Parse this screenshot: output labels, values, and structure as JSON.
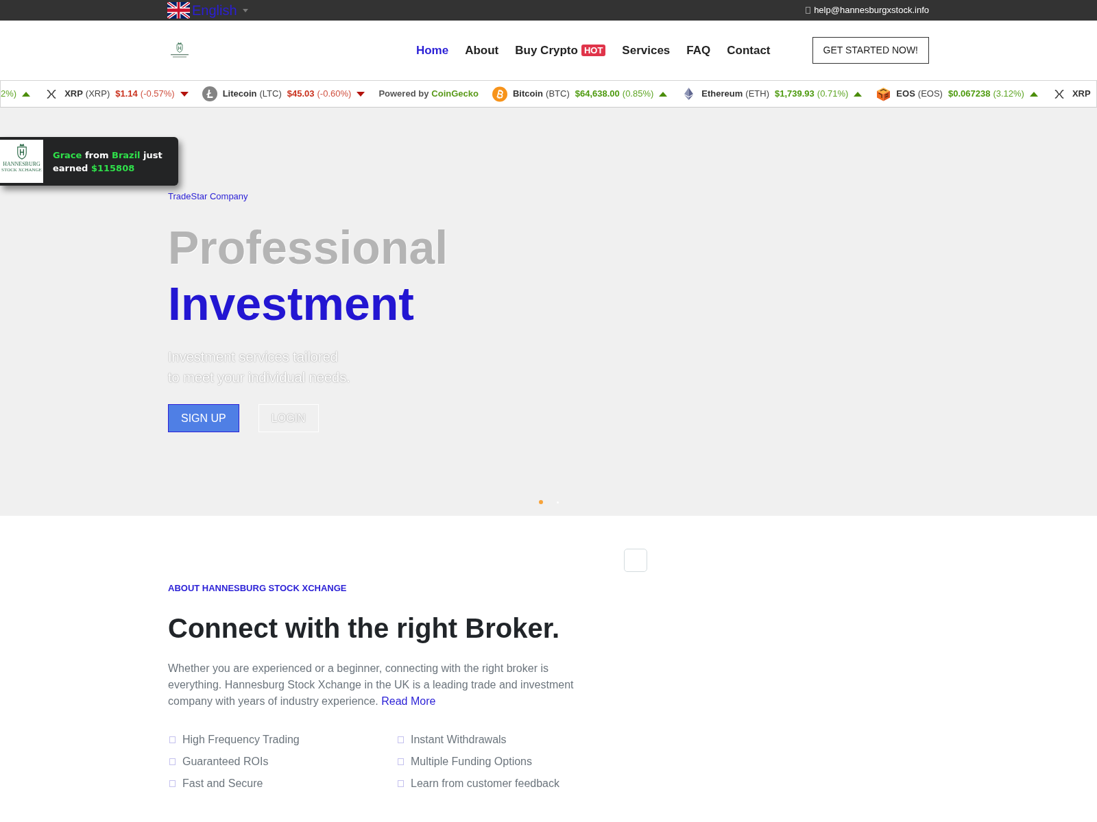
{
  "top_bar": {
    "language": "English",
    "email": "help@hannesburgxstock.info"
  },
  "header": {
    "nav": [
      {
        "label": "Home",
        "selected": true
      },
      {
        "label": "About",
        "selected": false
      },
      {
        "label": "Buy Crypto",
        "selected": false,
        "badge": "HOT"
      },
      {
        "label": "Services",
        "selected": false
      },
      {
        "label": "FAQ",
        "selected": false
      },
      {
        "label": "Contact",
        "selected": false
      }
    ],
    "cta": "GET STARTED NOW!"
  },
  "ticker": [
    {
      "kind": "partial",
      "change": "2%)",
      "rising": true
    },
    {
      "kind": "xrp",
      "name": "XRP",
      "symbol": "(XRP)",
      "price": "$1.14",
      "change": "(-0.57%)",
      "rising": false
    },
    {
      "kind": "litecoin",
      "name": "Litecoin",
      "symbol": "(LTC)",
      "price": "$45.03",
      "change": "(-0.60%)",
      "rising": false
    },
    {
      "kind": "credit",
      "label": "Powered by",
      "link": "CoinGecko"
    },
    {
      "kind": "bitcoin",
      "name": "Bitcoin",
      "symbol": "(BTC)",
      "price": "$64,638.00",
      "change": "(0.85%)",
      "rising": true
    },
    {
      "kind": "ethereum",
      "name": "Ethereum",
      "symbol": "(ETH)",
      "price": "$1,739.93",
      "change": "(0.71%)",
      "rising": true
    },
    {
      "kind": "eos",
      "name": "EOS",
      "symbol": "(EOS)",
      "price": "$0.067238",
      "change": "(3.12%)",
      "rising": true
    },
    {
      "kind": "xrp",
      "name": "XRP"
    }
  ],
  "notification": {
    "logo_lines": [
      "HANNESBURG",
      "STOCK XCHANGE"
    ],
    "parts": [
      {
        "text": "Grace",
        "highlight": true
      },
      {
        "text": "from",
        "highlight": false
      },
      {
        "text": "Brazil",
        "highlight": true
      },
      {
        "text": "just earned",
        "highlight": false
      },
      {
        "text": "$115808",
        "highlight": true
      }
    ]
  },
  "hero": {
    "eyebrow": "TradeStar Company",
    "title_lines": [
      {
        "text": "Professional",
        "accent": false
      },
      {
        "text": "Investment",
        "accent": true
      }
    ],
    "subtitle_lines": [
      "Investment services tailored",
      "to meet your individual needs."
    ],
    "buttons": [
      {
        "label": "SIGN UP",
        "kind": "primary"
      },
      {
        "label": "LOGIN",
        "kind": "outline"
      }
    ],
    "slide_dots": [
      {
        "selected": true
      },
      {
        "selected": false
      }
    ]
  },
  "about": {
    "eyebrow": "ABOUT HANNESBURG STOCK XCHANGE",
    "heading": "Connect with the right Broker.",
    "body": "Whether you are experienced or a beginner, connecting with the right broker is everything. Hannesburg Stock Xchange in the UK is a leading trade and investment company with years of industry experience.",
    "link": "Read More",
    "features": [
      "High Frequency Trading",
      "Instant Withdrawals",
      "Guaranteed ROIs",
      "Multiple Funding Options",
      "Fast and Secure",
      "Learn from customer feedback"
    ]
  }
}
